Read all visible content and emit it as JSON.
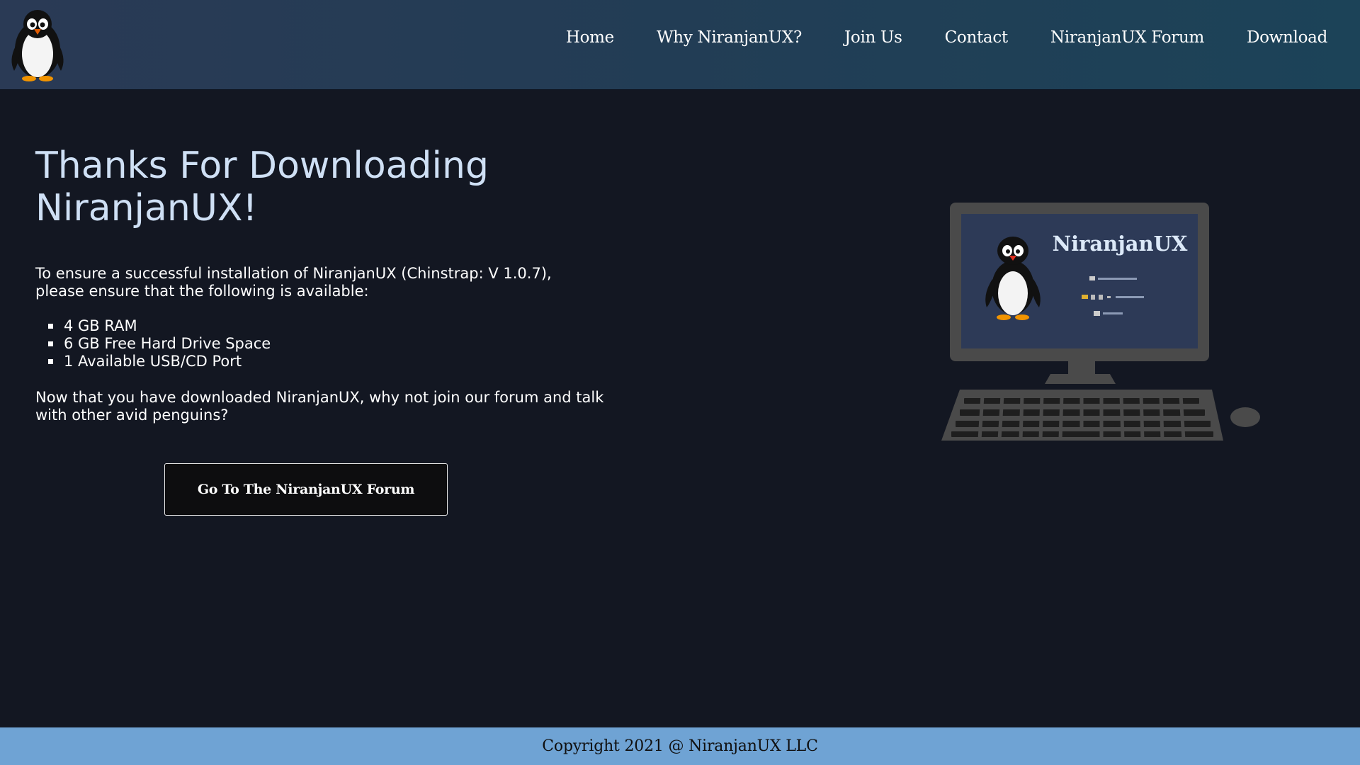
{
  "header": {
    "logo_icon": "penguin-icon",
    "nav": {
      "home": "Home",
      "why": "Why NiranjanUX?",
      "join": "Join Us",
      "contact": "Contact",
      "forum": "NiranjanUX Forum",
      "download": "Download"
    }
  },
  "main": {
    "title": "Thanks For Downloading NiranjanUX!",
    "intro": "To ensure a successful installation of NiranjanUX (Chinstrap: V 1.0.7), please ensure that the following is available:",
    "requirements": [
      "4 GB RAM",
      "6 GB Free Hard Drive Space",
      "1 Available USB/CD Port"
    ],
    "outro": "Now that you have downloaded NiranjanUX, why not join our forum and talk with other avid penguins?",
    "forum_button": "Go To The NiranjanUX Forum"
  },
  "illustration": {
    "screen_brand": "NiranjanUX",
    "icon": "computer-illustration"
  },
  "footer": {
    "copyright": "Copyright 2021 @ NiranjanUX LLC"
  },
  "colors": {
    "header_start": "#2a3a55",
    "header_end": "#1c4358",
    "background": "#131722",
    "title": "#cfe0f5",
    "footer": "#6fa3d4",
    "button_bg": "#0d0d0f"
  }
}
